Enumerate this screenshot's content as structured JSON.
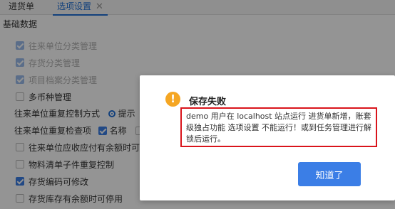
{
  "tabs": [
    {
      "label": "进货单"
    },
    {
      "label": "选项设置",
      "close": "✕"
    }
  ],
  "section_title": "基础数据",
  "options": [
    {
      "label": "往来单位分类管理",
      "checked": true,
      "disabled": true
    },
    {
      "label": "存货分类管理",
      "checked": true,
      "disabled": true
    },
    {
      "label": "项目档案分类管理",
      "checked": true,
      "disabled": true
    },
    {
      "label": "多币种管理",
      "checked": false,
      "disabled": false
    }
  ],
  "dup_control": {
    "label": "往来单位重复控制方式",
    "radio_selected": "提示"
  },
  "dup_check": {
    "label": "往来单位重复检查项",
    "item1": "名称"
  },
  "options2": [
    {
      "label": "往来单位应收应付有余额时可停用",
      "checked": false
    },
    {
      "label": "物料清单子件重复控制",
      "checked": false
    },
    {
      "label": "存货编码可修改",
      "checked": true
    },
    {
      "label": "存货库存有余额时可停用",
      "checked": false
    }
  ],
  "dialog": {
    "title": "保存失败",
    "message": "demo 用户在 localhost 站点运行 进货单新增，账套级独占功能 选项设置 不能运行！或到任务管理进行解锁后运行。",
    "ok_label": "知道了",
    "icon": "warning-icon",
    "accent": "#3b7ee6",
    "highlight_border": "#d9141b"
  }
}
